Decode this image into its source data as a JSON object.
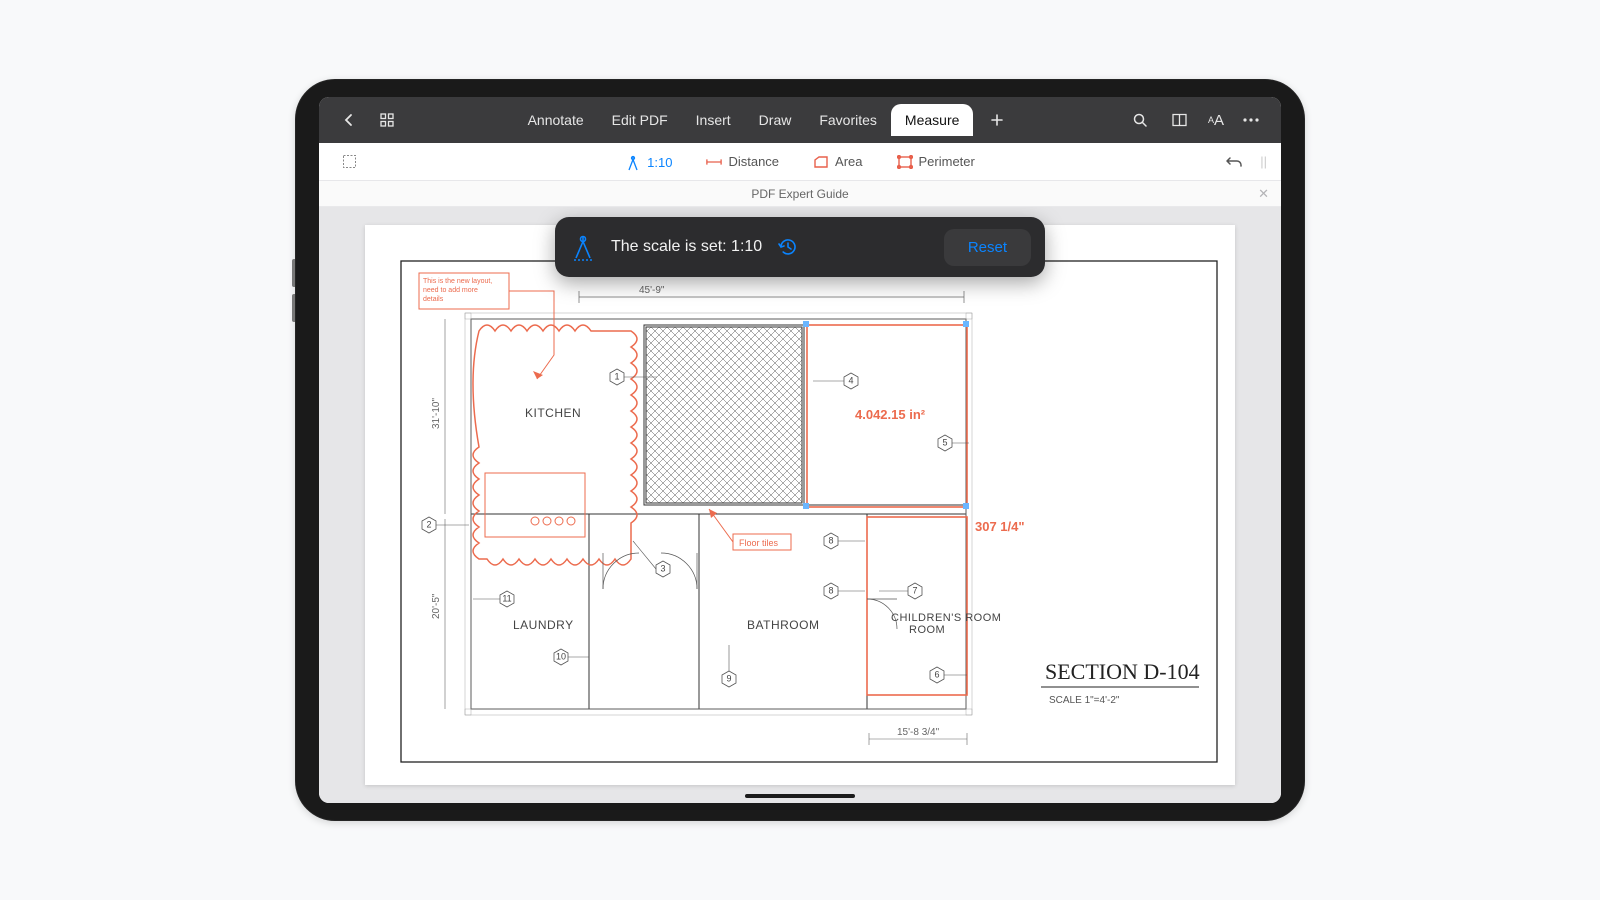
{
  "topbar": {
    "tabs": [
      "Annotate",
      "Edit PDF",
      "Insert",
      "Draw",
      "Favorites",
      "Measure"
    ],
    "active_tab": "Measure"
  },
  "measure_bar": {
    "scale": "1:10",
    "items": [
      "Distance",
      "Area",
      "Perimeter"
    ]
  },
  "document": {
    "title": "PDF Expert Guide"
  },
  "toast": {
    "text": "The scale is set: 1:10",
    "reset_label": "Reset"
  },
  "floorplan": {
    "top_dim": "45'-9\"",
    "left_dim_upper": "31'-10\"",
    "left_dim_lower": "20'-5\"",
    "bottom_dim": "15'-8 3/4\"",
    "rooms": {
      "kitchen": "KITCHEN",
      "laundry": "LAUNDRY",
      "bathroom": "BATHROOM",
      "children": "CHILDREN'S ROOM"
    },
    "annotations": {
      "layout_note": "This is the new layout, need to add more details",
      "floor_tiles": "Floor tiles",
      "area_value": "4.042.15 in²",
      "perimeter_value": "307 1/4\""
    },
    "title_block": {
      "section": "SECTION D-104",
      "scale": "SCALE 1\"=4'-2\""
    },
    "callouts": [
      "1",
      "2",
      "4",
      "5",
      "7",
      "8",
      "8",
      "9",
      "10",
      "11",
      "3",
      "6"
    ]
  }
}
